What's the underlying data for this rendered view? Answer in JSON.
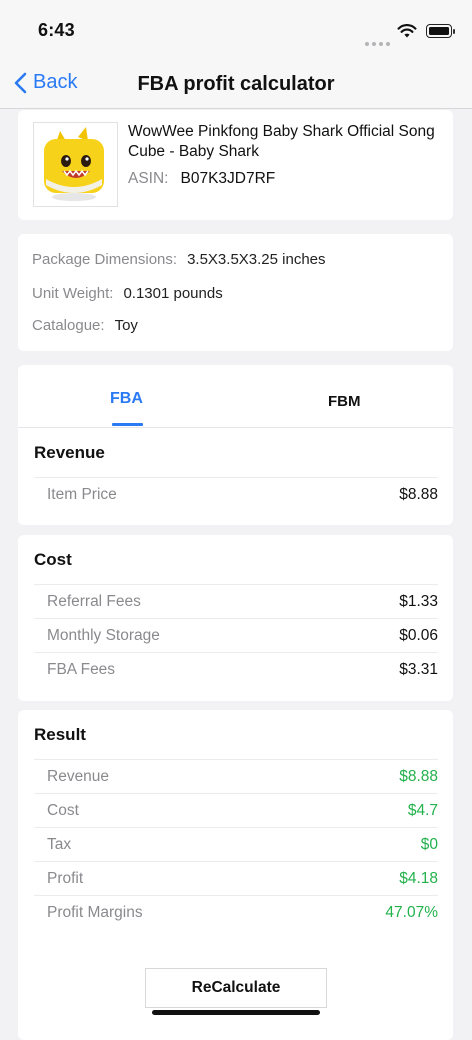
{
  "status": {
    "time": "6:43"
  },
  "nav": {
    "back_label": "Back",
    "title": "FBA profit calculator"
  },
  "product": {
    "name": "WowWee Pinkfong Baby Shark Official Song Cube - Baby Shark",
    "asin_label": "ASIN:",
    "asin": "B07K3JD7RF"
  },
  "details": {
    "dimensions_label": "Package Dimensions:",
    "dimensions": "3.5X3.5X3.25 inches",
    "weight_label": "Unit Weight:",
    "weight": "0.1301 pounds",
    "catalogue_label": "Catalogue:",
    "catalogue": "Toy"
  },
  "tabs": {
    "fba": "FBA",
    "fbm": "FBM",
    "active": "FBA"
  },
  "revenue": {
    "title": "Revenue",
    "item_price_label": "Item Price",
    "item_price": "$8.88"
  },
  "cost": {
    "title": "Cost",
    "rows": [
      {
        "label": "Referral Fees",
        "value": "$1.33"
      },
      {
        "label": "Monthly Storage",
        "value": "$0.06"
      },
      {
        "label": "FBA Fees",
        "value": "$3.31"
      }
    ]
  },
  "result": {
    "title": "Result",
    "rows": [
      {
        "label": "Revenue",
        "value": "$8.88"
      },
      {
        "label": "Cost",
        "value": "$4.7"
      },
      {
        "label": "Tax",
        "value": "$0"
      },
      {
        "label": "Profit",
        "value": "$4.18"
      },
      {
        "label": "Profit Margins",
        "value": "47.07%"
      }
    ],
    "recalc_label": "ReCalculate"
  },
  "colors": {
    "accent": "#2a7af3",
    "positive": "#22b24c"
  }
}
